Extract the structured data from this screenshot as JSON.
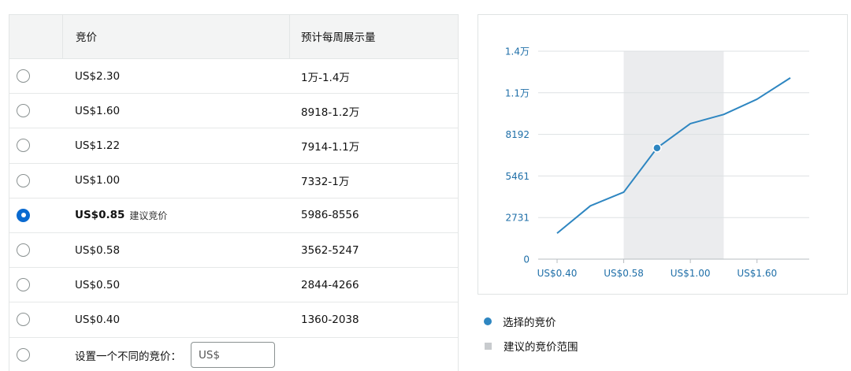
{
  "table": {
    "header": {
      "bid": "竞价",
      "impressions": "预计每周展示量"
    },
    "rows": [
      {
        "bid": "US$2.30",
        "impressions": "1万-1.4万",
        "selected": false,
        "tag": ""
      },
      {
        "bid": "US$1.60",
        "impressions": "8918-1.2万",
        "selected": false,
        "tag": ""
      },
      {
        "bid": "US$1.22",
        "impressions": "7914-1.1万",
        "selected": false,
        "tag": ""
      },
      {
        "bid": "US$1.00",
        "impressions": "7332-1万",
        "selected": false,
        "tag": ""
      },
      {
        "bid": "US$0.85",
        "impressions": "5986-8556",
        "selected": true,
        "tag": "建议竞价"
      },
      {
        "bid": "US$0.58",
        "impressions": "3562-5247",
        "selected": false,
        "tag": ""
      },
      {
        "bid": "US$0.50",
        "impressions": "2844-4266",
        "selected": false,
        "tag": ""
      },
      {
        "bid": "US$0.40",
        "impressions": "1360-2038",
        "selected": false,
        "tag": ""
      }
    ],
    "custom": {
      "label": "设置一个不同的竞价：",
      "placeholder": "US$"
    }
  },
  "legend": {
    "selected_bid": "选择的竞价",
    "suggested_range": "建议的竞价范围"
  },
  "colors": {
    "line": "#2e86c1",
    "axis_text": "#1f6fa8",
    "band": "#ebecee",
    "selected_radio": "#0a6ad0"
  },
  "chart_data": {
    "type": "line",
    "x_ticks": [
      "US$0.40",
      "US$0.58",
      "US$1.00",
      "US$1.60"
    ],
    "y_ticks": [
      "0",
      "2731",
      "5461",
      "8192",
      "1.1万",
      "1.4万"
    ],
    "y_tick_values": [
      0,
      2731,
      5461,
      8192,
      10922,
      13653
    ],
    "ylim": [
      0,
      13653
    ],
    "x_categories": [
      "US$0.40",
      "US$0.50",
      "US$0.58",
      "US$0.85",
      "US$1.00",
      "US$1.22",
      "US$1.60",
      "US$2.30"
    ],
    "values": [
      1700,
      3500,
      4400,
      7300,
      8900,
      9500,
      10500,
      11900
    ],
    "selected_index": 3,
    "suggested_range": [
      "US$0.58",
      "US$1.22"
    ],
    "grid": true
  }
}
